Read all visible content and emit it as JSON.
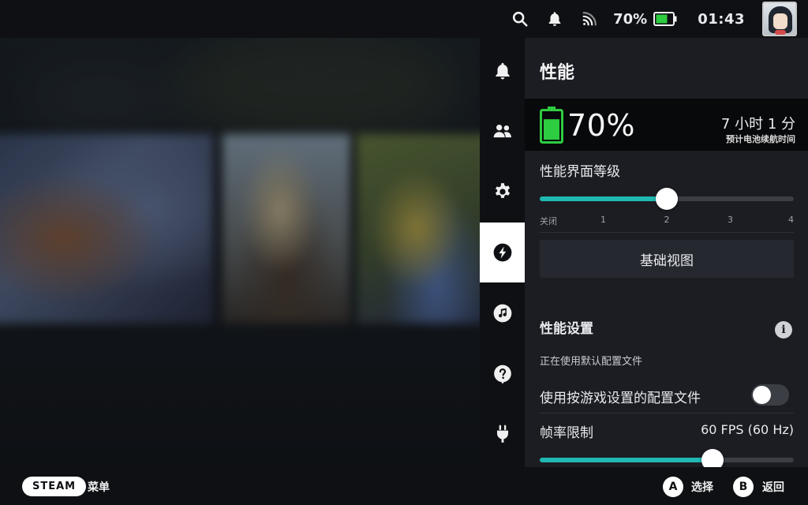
{
  "topbar": {
    "icons": [
      "search-icon",
      "bell-icon",
      "wifi-icon"
    ],
    "battery_percent_text": "70%",
    "battery_level": 0.7,
    "clock": "01:43",
    "avatar": "user-avatar"
  },
  "qam": {
    "tabs": [
      {
        "name": "notifications",
        "icon": "bell-icon",
        "active": false
      },
      {
        "name": "friends",
        "icon": "friends-icon",
        "active": false
      },
      {
        "name": "settings",
        "icon": "gear-icon",
        "active": false
      },
      {
        "name": "performance",
        "icon": "lightning-icon",
        "active": true
      },
      {
        "name": "music",
        "icon": "music-note-icon",
        "active": false
      },
      {
        "name": "help",
        "icon": "help-icon",
        "active": false
      },
      {
        "name": "power",
        "icon": "plug-icon",
        "active": false
      }
    ]
  },
  "panel": {
    "title": "性能",
    "battery": {
      "percent_text": "70%",
      "level": 0.7,
      "time_remaining": "7 小时 1 分",
      "time_caption": "预计电池续航时间"
    },
    "overlay_level": {
      "label": "性能界面等级",
      "ticks": [
        "关闭",
        "1",
        "2",
        "3",
        "4"
      ],
      "selected_index": 2,
      "max_index": 4
    },
    "basic_view_button": "基础视图",
    "perf_settings": {
      "heading": "性能设置",
      "info_icon": "i",
      "status_note": "正在使用默认配置文件",
      "per_game_profile_label": "使用按游戏设置的配置文件",
      "per_game_profile_on": false,
      "framerate_label": "帧率限制",
      "framerate_value": "60 FPS (60 Hz)",
      "framerate_fraction": 0.68
    }
  },
  "bottombar": {
    "steam_label": "STEAM",
    "menu_label": "菜单",
    "a_glyph": "A",
    "a_label": "选择",
    "b_glyph": "B",
    "b_label": "返回"
  },
  "colors": {
    "accent": "#1fb8b2",
    "battery_green": "#2ecc40",
    "panel_bg": "#1b1d22",
    "bar_bg": "#0e1013"
  }
}
